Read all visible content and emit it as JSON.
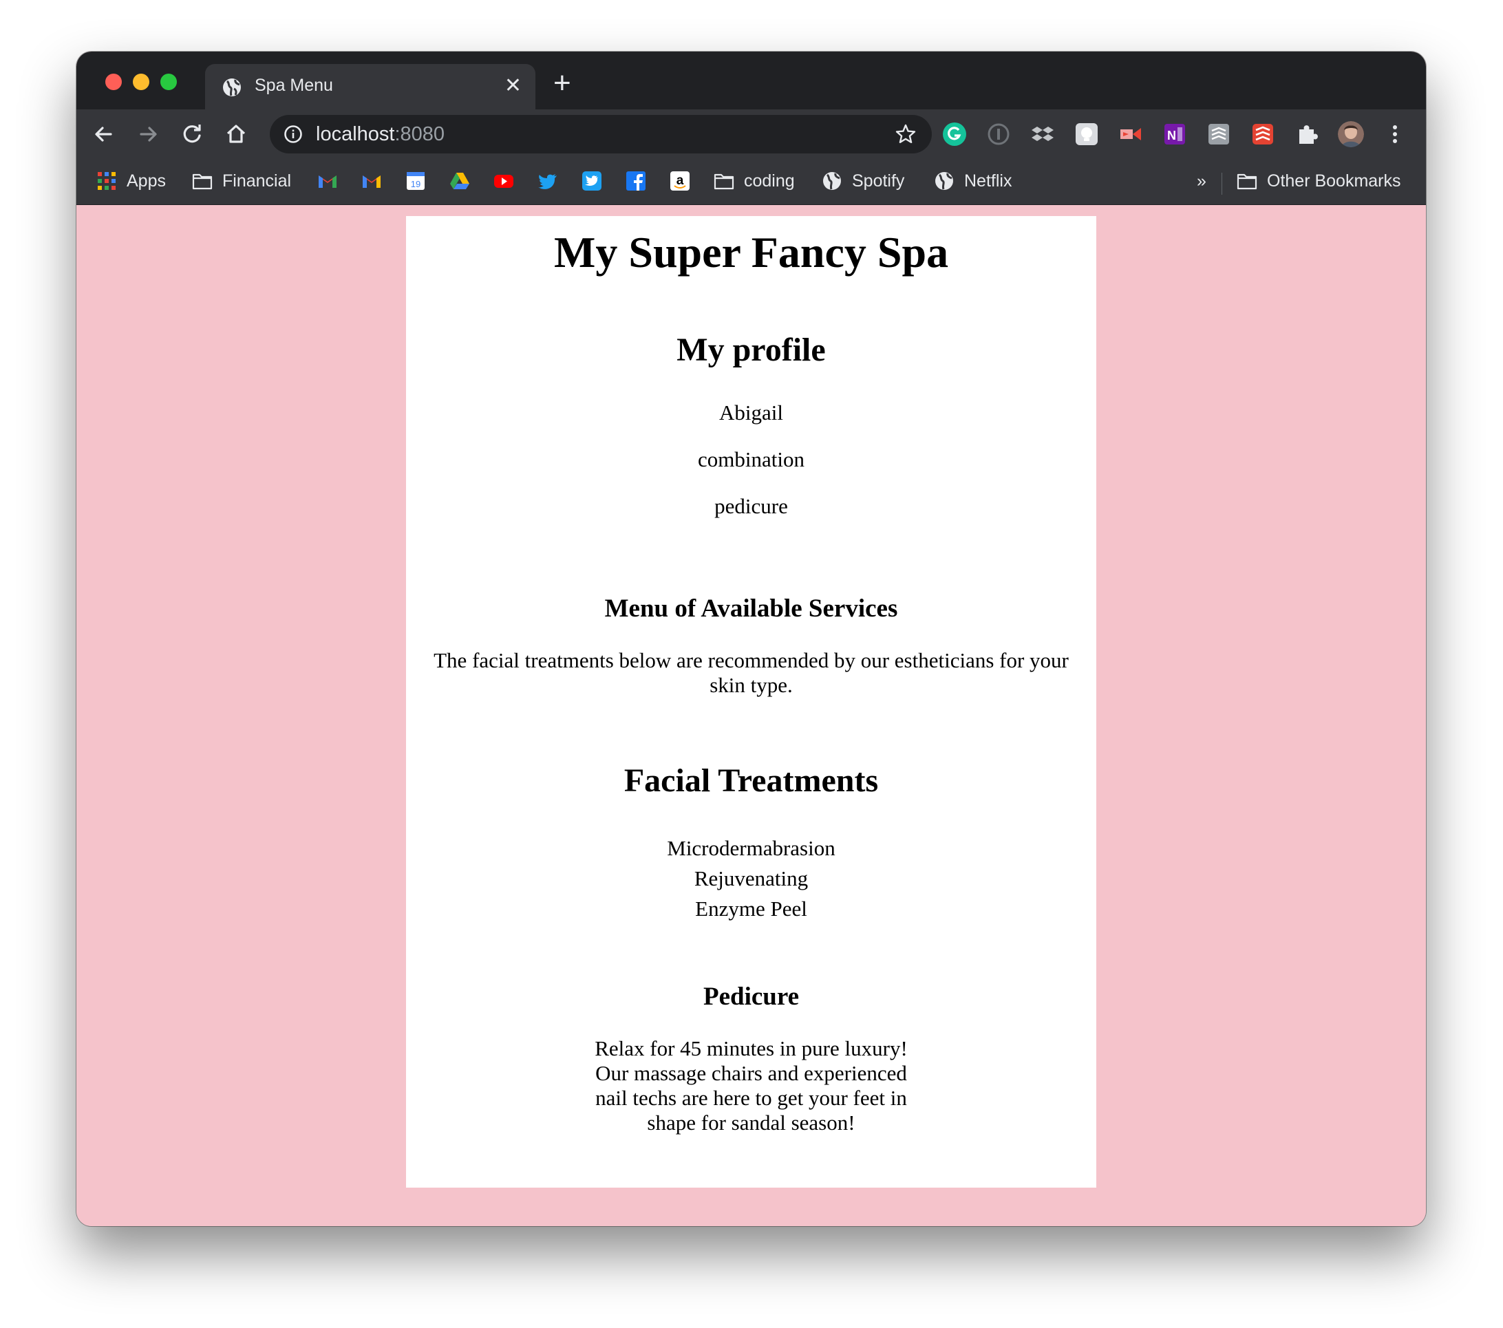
{
  "browser": {
    "tab_title": "Spa Menu",
    "url_host": "localhost",
    "url_port": ":8080",
    "bookmarks": {
      "apps": "Apps",
      "financial": "Financial",
      "calendar_day": "19",
      "coding": "coding",
      "spotify": "Spotify",
      "netflix": "Netflix",
      "overflow": "»",
      "other": "Other Bookmarks"
    }
  },
  "page": {
    "title": "My Super Fancy Spa",
    "profile": {
      "heading": "My profile",
      "name": "Abigail",
      "skin_type": "combination",
      "service": "pedicure"
    },
    "menu": {
      "heading": "Menu of Available Services",
      "intro": "The facial treatments below are recommended by our estheticians for your skin type."
    },
    "facials": {
      "heading": "Facial Treatments",
      "items": [
        "Microdermabrasion",
        "Rejuvenating",
        "Enzyme Peel"
      ]
    },
    "pedicure": {
      "heading": "Pedicure",
      "description": "Relax for 45 minutes in pure luxury! Our massage chairs and experienced nail techs are here to get your feet in shape for sandal season!"
    }
  },
  "colors": {
    "page_background": "#f5c3cb",
    "browser_chrome": "#35363a"
  }
}
